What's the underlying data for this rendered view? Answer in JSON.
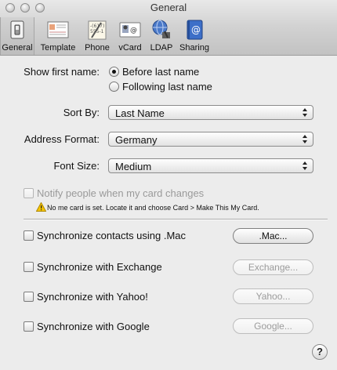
{
  "window": {
    "title": "General"
  },
  "toolbar": {
    "items": [
      {
        "label": "General",
        "icon": "general-switch-icon",
        "selected": true
      },
      {
        "label": "Template",
        "icon": "template-card-icon",
        "selected": false
      },
      {
        "label": "Phone",
        "icon": "phone-notepad-icon",
        "selected": false
      },
      {
        "label": "vCard",
        "icon": "vcard-icon",
        "selected": false
      },
      {
        "label": "LDAP",
        "icon": "ldap-globe-icon",
        "selected": false
      },
      {
        "label": "Sharing",
        "icon": "sharing-book-icon",
        "selected": false
      }
    ]
  },
  "show_first_name": {
    "label": "Show first name:",
    "options": [
      {
        "label": "Before last name",
        "selected": true
      },
      {
        "label": "Following last name",
        "selected": false
      }
    ]
  },
  "sort_by": {
    "label": "Sort By:",
    "value": "Last Name"
  },
  "address_format": {
    "label": "Address Format:",
    "value": "Germany"
  },
  "font_size": {
    "label": "Font Size:",
    "value": "Medium"
  },
  "notify": {
    "label": "Notify people when my card changes",
    "checked": false,
    "enabled": false,
    "warning": "No me card is set. Locate it and choose Card > Make This My Card."
  },
  "sync": [
    {
      "label": "Synchronize contacts using .Mac",
      "button": ".Mac...",
      "button_enabled": true
    },
    {
      "label": "Synchronize with Exchange",
      "button": "Exchange...",
      "button_enabled": false
    },
    {
      "label": "Synchronize with Yahoo!",
      "button": "Yahoo...",
      "button_enabled": false
    },
    {
      "label": "Synchronize with Google",
      "button": "Google...",
      "button_enabled": false
    }
  ],
  "help": {
    "label": "?"
  },
  "colors": {
    "warning": "#f5c400",
    "selected_toolbar": "#c4c4c4"
  }
}
